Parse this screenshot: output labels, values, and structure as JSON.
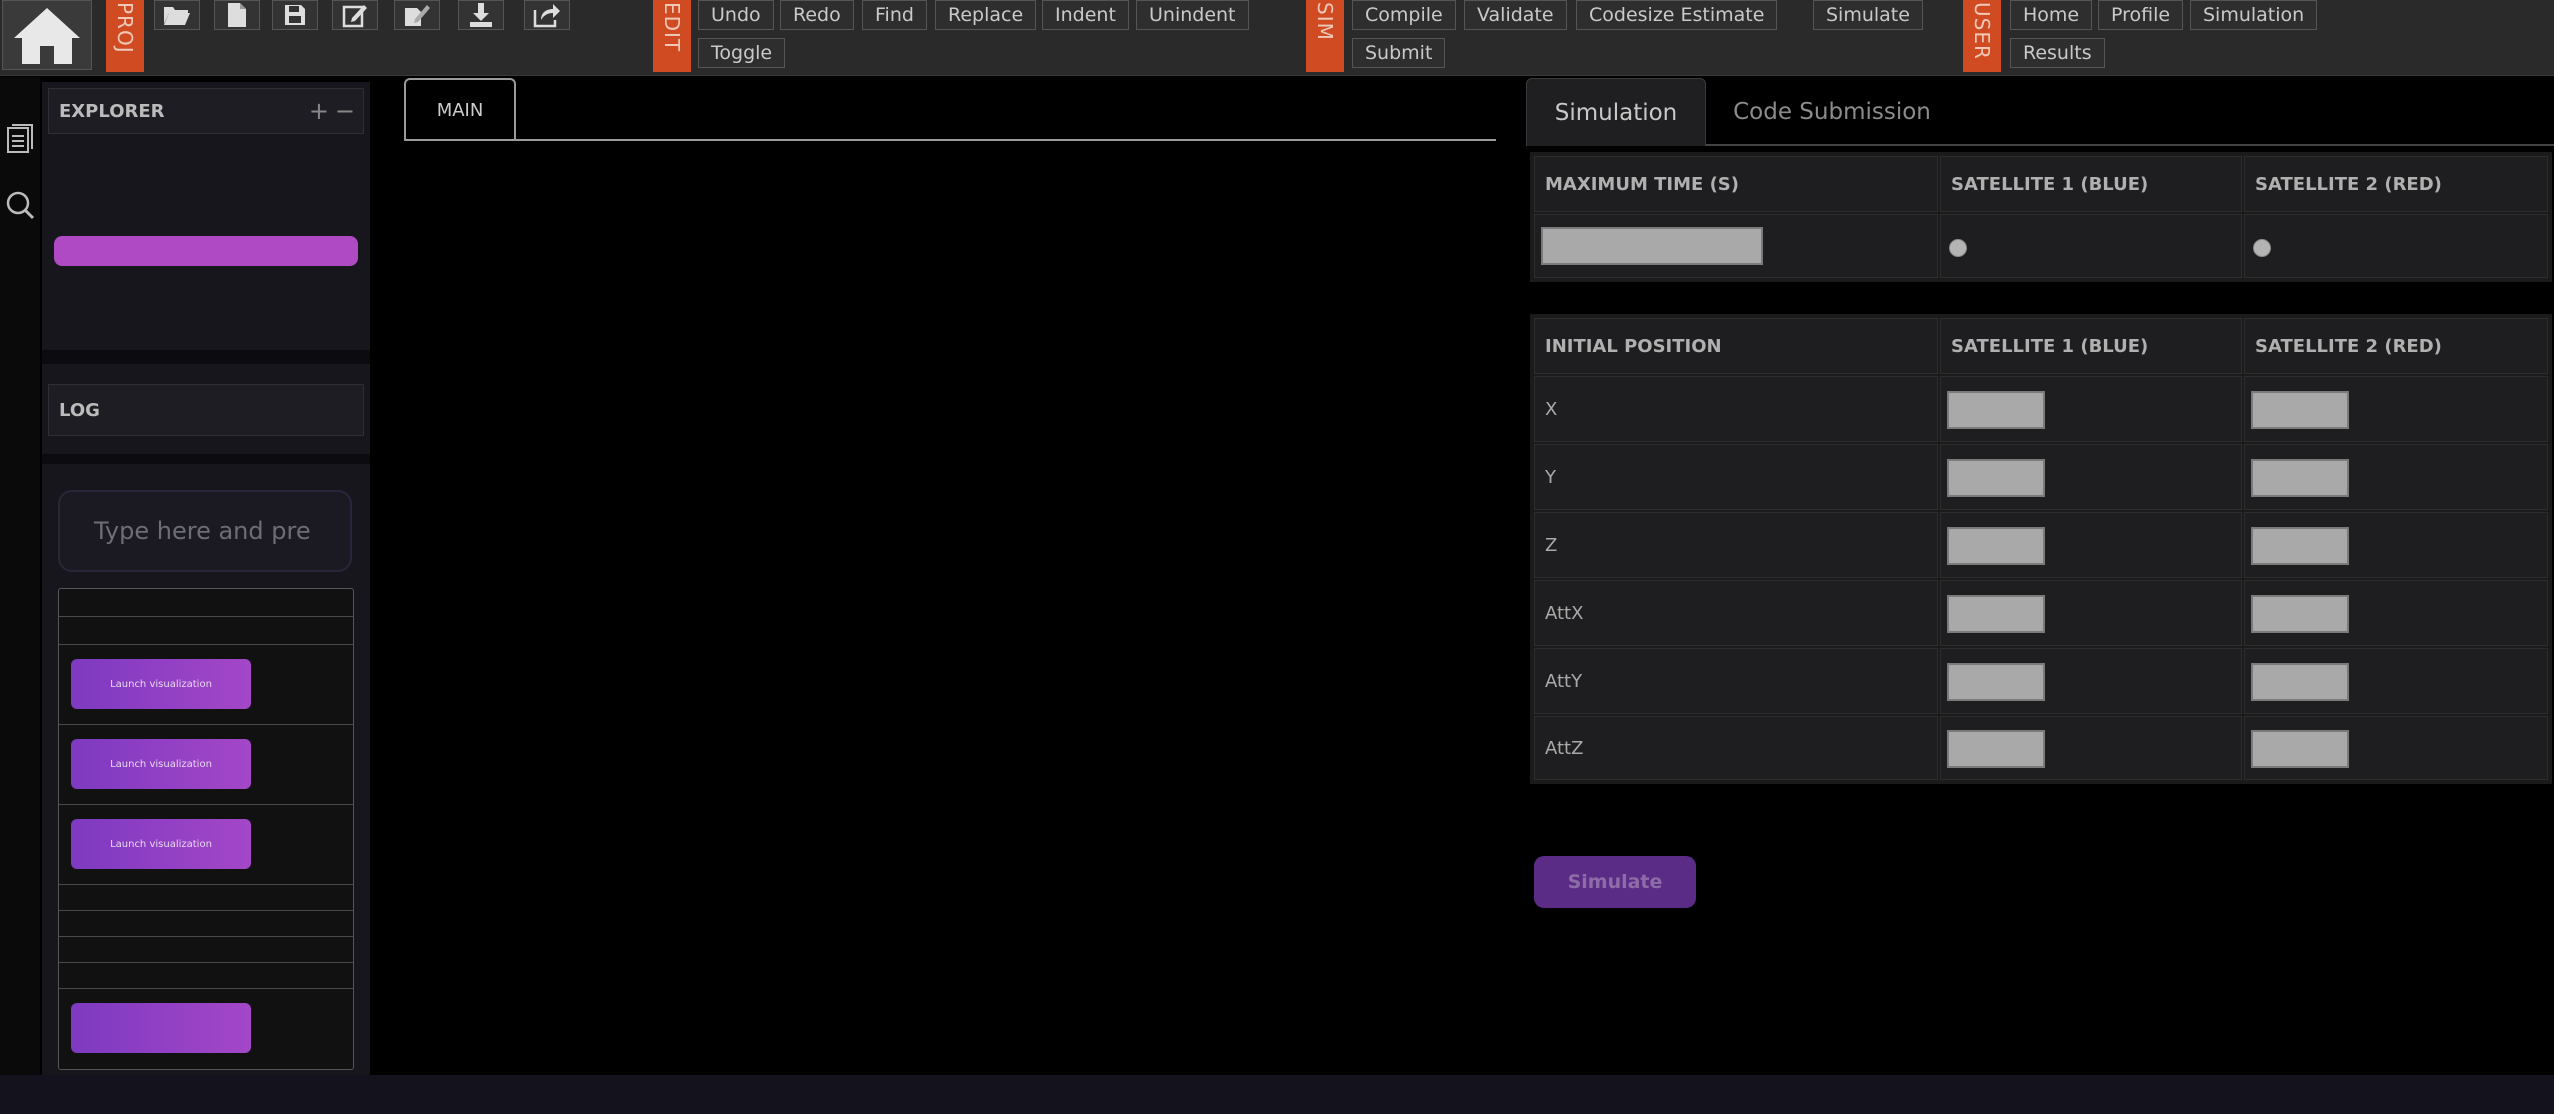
{
  "toolbar": {
    "categories": {
      "proj": "PROJ",
      "edit": "EDIT",
      "sim": "SIM",
      "user": "USER"
    },
    "edit_buttons": [
      "Undo",
      "Redo",
      "Find",
      "Replace",
      "Indent",
      "Unindent",
      "Toggle"
    ],
    "sim_buttons": [
      "Compile",
      "Validate",
      "Codesize Estimate",
      "Simulate",
      "Submit"
    ],
    "user_buttons": [
      "Home",
      "Profile",
      "Simulation",
      "Results"
    ],
    "project_icons": [
      "folder-open-icon",
      "new-file-icon",
      "save-icon",
      "edit-icon",
      "edit-multiple-icon",
      "download-icon",
      "share-icon"
    ],
    "accent_color": "#d04a22"
  },
  "sidebar": {
    "explorer_title": "EXPLORER",
    "log_title": "LOG",
    "chat_placeholder": "Type here and pre",
    "launch_label": "Launch visualization",
    "pill_color": "#b049c4"
  },
  "editor": {
    "tab_label": "MAIN"
  },
  "right_panel": {
    "tabs": [
      "Simulation",
      "Code Submission"
    ],
    "time_table": {
      "headers": [
        "MAXIMUM TIME (S)",
        "SATELLITE 1 (BLUE)",
        "SATELLITE 2 (RED)"
      ]
    },
    "position_table": {
      "headers": [
        "INITIAL POSITION",
        "SATELLITE 1 (BLUE)",
        "SATELLITE 2 (RED)"
      ],
      "rows": [
        "X",
        "Y",
        "Z",
        "AttX",
        "AttY",
        "AttZ"
      ]
    },
    "simulate_label": "Simulate"
  }
}
